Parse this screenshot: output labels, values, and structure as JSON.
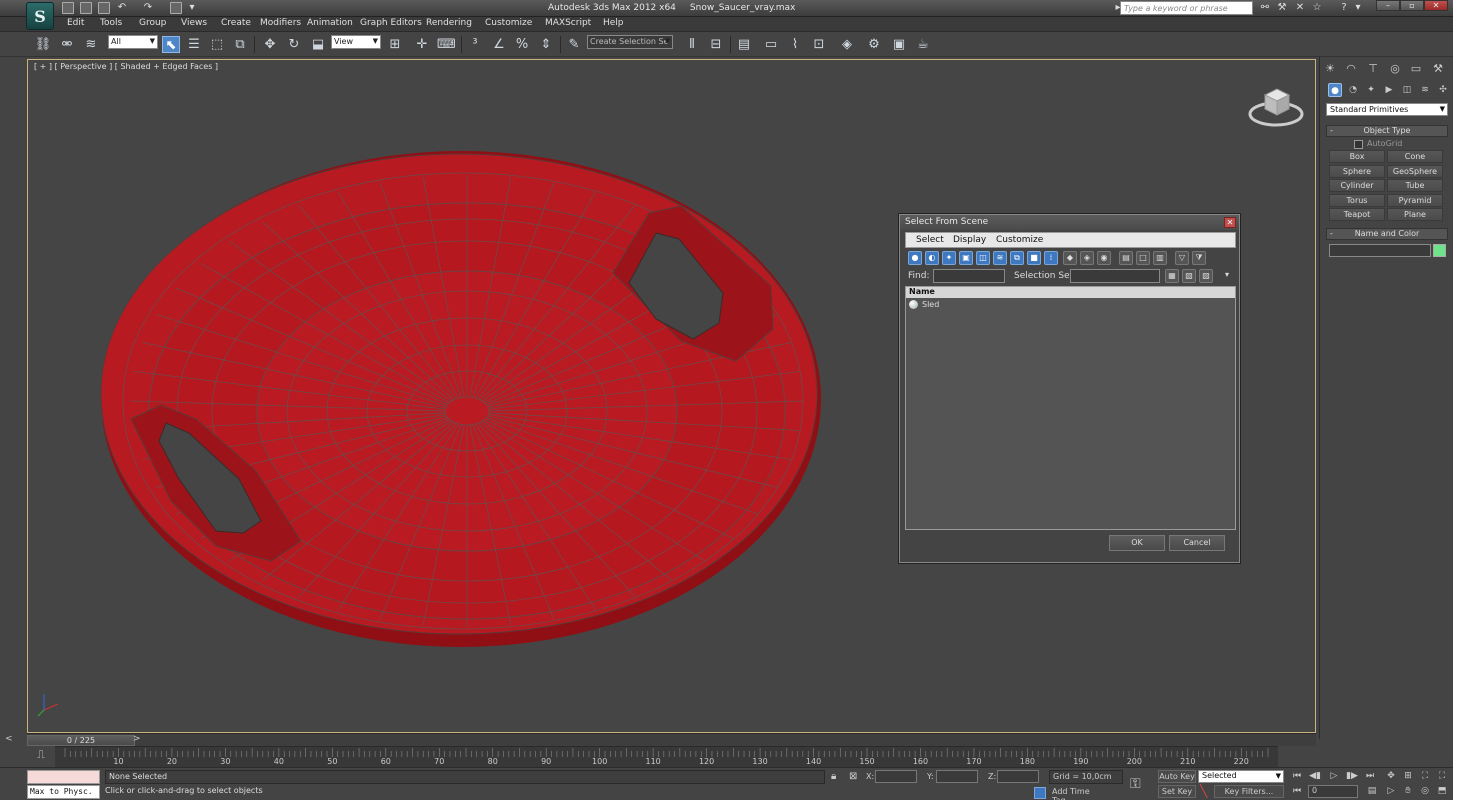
{
  "titlebar": {
    "logo": "S",
    "app": "Autodesk 3ds Max  2012 x64",
    "file": "Snow_Saucer_vray.max",
    "search_placeholder": "Type a keyword or phrase",
    "icons": [
      "binoculars-icon",
      "comm-center-icon",
      "favorites-icon",
      "help-icon"
    ]
  },
  "menu": [
    "Edit",
    "Tools",
    "Group",
    "Views",
    "Create",
    "Modifiers",
    "Animation",
    "Graph Editors",
    "Rendering",
    "Customize",
    "MAXScript",
    "Help"
  ],
  "toolbar": {
    "filter_value": "All",
    "ref_coord_value": "View",
    "selection_set_placeholder": "Create Selection Se"
  },
  "viewport": {
    "label": "[ + ] [ Perspective ] [ Shaded + Edged Faces ]",
    "object_color": "#b8191f"
  },
  "dialog": {
    "title": "Select From Scene",
    "menu": [
      "Select",
      "Display",
      "Customize"
    ],
    "find_label": "Find:",
    "selection_set_label": "Selection Set:",
    "column_header": "Name",
    "objects": [
      "Sled"
    ],
    "ok_label": "OK",
    "cancel_label": "Cancel"
  },
  "command_panel": {
    "category": "Standard Primitives",
    "object_type_title": "Object Type",
    "autogrid_label": "AutoGrid",
    "buttons": [
      "Box",
      "Cone",
      "Sphere",
      "GeoSphere",
      "Cylinder",
      "Tube",
      "Torus",
      "Pyramid",
      "Teapot",
      "Plane"
    ],
    "name_color_title": "Name and Color",
    "color": "#6ee38a"
  },
  "timeline": {
    "slider_text": "0 / 225",
    "frame_labels": [
      "10",
      "20",
      "30",
      "40",
      "50",
      "60",
      "70",
      "80",
      "90",
      "100",
      "110",
      "120",
      "130",
      "140",
      "150",
      "160",
      "170",
      "180",
      "190",
      "200",
      "210",
      "220"
    ]
  },
  "status": {
    "maxscript_listener": "Max to Physc.",
    "selection": "None Selected",
    "prompt": "Click or click-and-drag to select objects",
    "x_label": "X:",
    "y_label": "Y:",
    "z_label": "Z:",
    "grid": "Grid = 10,0cm",
    "add_time_tag": "Add Time Tag",
    "auto_key": "Auto Key",
    "set_key": "Set Key",
    "key_mode": "Selected",
    "key_filters": "Key Filters...",
    "current_frame": "0"
  }
}
